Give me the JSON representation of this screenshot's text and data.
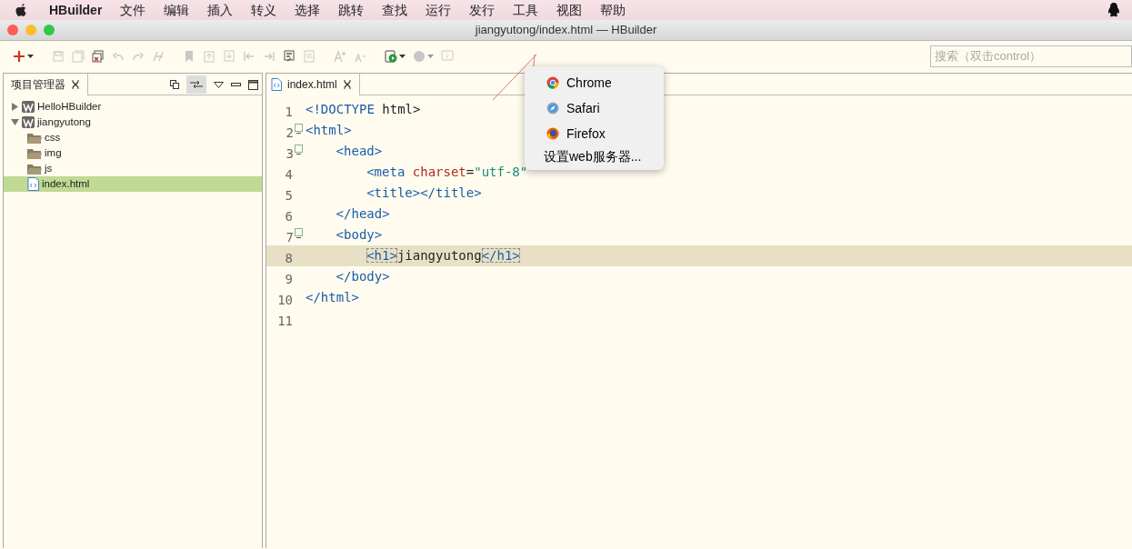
{
  "menu_bar": {
    "app": "HBuilder",
    "items": [
      "文件",
      "编辑",
      "插入",
      "转义",
      "选择",
      "跳转",
      "查找",
      "运行",
      "发行",
      "工具",
      "视图",
      "帮助"
    ]
  },
  "window": {
    "title": "jiangyutong/index.html — HBuilder"
  },
  "toolbar": {
    "groups": [
      [
        {
          "kind": "new",
          "disabled": false,
          "dropdown": true
        }
      ],
      [
        {
          "kind": "save",
          "disabled": true
        },
        {
          "kind": "save-all",
          "disabled": true
        },
        {
          "kind": "close-all",
          "disabled": false
        },
        {
          "kind": "undo",
          "disabled": true
        },
        {
          "kind": "redo",
          "disabled": true
        },
        {
          "kind": "format",
          "disabled": true
        }
      ],
      [
        {
          "kind": "bookmark",
          "disabled": true
        },
        {
          "kind": "page-up",
          "disabled": true
        },
        {
          "kind": "page-down",
          "disabled": true
        },
        {
          "kind": "prev",
          "disabled": true
        },
        {
          "kind": "next",
          "disabled": true
        },
        {
          "kind": "comment",
          "disabled": false
        },
        {
          "kind": "uncomment",
          "disabled": true
        }
      ],
      [
        {
          "kind": "font-up",
          "disabled": true
        },
        {
          "kind": "font-down",
          "disabled": true
        }
      ],
      [
        {
          "kind": "run",
          "disabled": false,
          "dropdown": true
        },
        {
          "kind": "browser",
          "disabled": true,
          "dropdown": true
        },
        {
          "kind": "info",
          "disabled": true
        }
      ]
    ],
    "search": {
      "placeholder": "搜索（双击control）"
    }
  },
  "project_panel": {
    "tab": "项目管理器",
    "tree": [
      {
        "label": "HelloHBuilder",
        "kind": "project",
        "expanded": false,
        "selected": false
      },
      {
        "label": "jiangyutong",
        "kind": "project",
        "expanded": true,
        "selected": false,
        "children": [
          {
            "label": "css",
            "kind": "folder",
            "selected": false
          },
          {
            "label": "img",
            "kind": "folder",
            "selected": false
          },
          {
            "label": "js",
            "kind": "folder",
            "selected": false
          },
          {
            "label": "index.html",
            "kind": "file",
            "selected": true
          }
        ]
      }
    ]
  },
  "editor": {
    "tab": "index.html",
    "lines": [
      {
        "number": "1",
        "foldable": false,
        "current": false,
        "tokens": [
          {
            "kind": "tag",
            "text": "<!DOCTYPE"
          },
          {
            "kind": "plain",
            "text": " html>"
          }
        ]
      },
      {
        "number": "2",
        "foldable": true,
        "current": false,
        "tokens": [
          {
            "kind": "tag",
            "text": "<html>"
          }
        ],
        "children": [
          {
            "number": "3",
            "foldable": true,
            "current": false,
            "tokens": [
              {
                "kind": "tag",
                "text": "<head>"
              }
            ],
            "children": [
              {
                "number": "4",
                "foldable": false,
                "current": false,
                "tokens": [
                  {
                    "kind": "tag",
                    "text": "<meta"
                  },
                  {
                    "kind": "attr",
                    "text": " charset"
                  },
                  {
                    "kind": "plain",
                    "text": "="
                  },
                  {
                    "kind": "string",
                    "text": "\"utf-8\""
                  }
                ]
              },
              {
                "number": "5",
                "foldable": false,
                "current": false,
                "tokens": [
                  {
                    "kind": "tag",
                    "text": "<title></title>"
                  }
                ]
              }
            ]
          },
          {
            "number": "6",
            "foldable": false,
            "current": false,
            "tokens": [
              {
                "kind": "tag",
                "text": "</head>"
              }
            ]
          },
          {
            "number": "7",
            "foldable": true,
            "current": false,
            "tokens": [
              {
                "kind": "tag",
                "text": "<body>"
              }
            ],
            "children": [
              {
                "number": "8",
                "foldable": false,
                "current": true,
                "tokens": [
                  {
                    "kind": "tag-match",
                    "text": "<h1>"
                  },
                  {
                    "kind": "plain",
                    "text": "jiangyutong"
                  },
                  {
                    "kind": "tag-match",
                    "text": "</h1>"
                  }
                ]
              }
            ]
          },
          {
            "number": "9",
            "foldable": false,
            "current": false,
            "tokens": [
              {
                "kind": "tag",
                "text": "</body>"
              }
            ]
          }
        ]
      },
      {
        "number": "10",
        "foldable": false,
        "current": false,
        "tokens": [
          {
            "kind": "tag",
            "text": "</html>"
          }
        ]
      },
      {
        "number": "11",
        "foldable": false,
        "current": false
      }
    ]
  },
  "browser_menu": {
    "items": [
      {
        "label": "Chrome",
        "kind": "chrome"
      },
      {
        "label": "Safari",
        "kind": "safari"
      },
      {
        "label": "Firefox",
        "kind": "firefox"
      },
      {
        "label": "设置web服务器...",
        "kind": "plain"
      }
    ]
  }
}
